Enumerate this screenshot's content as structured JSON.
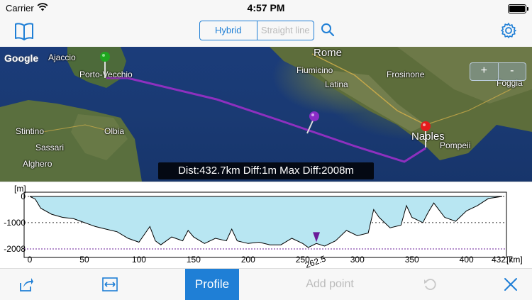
{
  "status_bar": {
    "carrier": "Carrier",
    "time": "4:57 PM"
  },
  "nav": {
    "modes": [
      "Hybrid",
      "Straight line"
    ],
    "selected_mode": "Hybrid",
    "icons": [
      "book-icon",
      "search-icon",
      "gear-icon"
    ]
  },
  "map": {
    "provider": "Google",
    "cities": {
      "ajaccio": "Ajaccio",
      "porto_vecchio": "Porto-Vecchio",
      "rome": "Rome",
      "fiumicino": "Fiumicino",
      "frosinone": "Frosinone",
      "latina": "Latina",
      "naples": "Naples",
      "pompeii": "Pompeii",
      "foggia": "Foggia",
      "stintino": "Stintino",
      "olbia": "Olbia",
      "sassari": "Sassari",
      "alghero": "Alghero"
    },
    "zoom": {
      "in_label": "+",
      "out_label": "-"
    },
    "distance_label": "Dist:432.7km Diff:1m Max Diff:2008m",
    "colors": {
      "route": "#9b30c8",
      "start_pin": "#1fa51f",
      "end_pin": "#e51c1c",
      "mid_pin": "#8a2cc7"
    }
  },
  "profile": {
    "unit_y": "[m]",
    "unit_x": "[km]",
    "y_ticks": [
      "0",
      "-1000",
      "-2008"
    ],
    "x_ticks": [
      "0",
      "50",
      "100",
      "150",
      "200",
      "250",
      "300",
      "350",
      "400",
      "432.7"
    ],
    "marker_label": "262.5",
    "colors": {
      "fill": "#b8e6f2",
      "marker": "#6a1b9a",
      "min_line": "#6a1b9a"
    }
  },
  "toolbar": {
    "profile_label": "Profile",
    "add_point_label": "Add point",
    "icons": [
      "share-icon",
      "fit-width-icon",
      "undo-icon",
      "close-icon"
    ]
  },
  "chart_data": {
    "type": "area",
    "title": "",
    "xlabel": "[km]",
    "ylabel": "[m]",
    "xlim": [
      0,
      432.7
    ],
    "ylim": [
      -2008,
      0
    ],
    "x": [
      0,
      5,
      10,
      20,
      30,
      40,
      50,
      60,
      70,
      80,
      90,
      100,
      110,
      115,
      120,
      130,
      140,
      145,
      150,
      160,
      170,
      180,
      185,
      190,
      200,
      210,
      220,
      230,
      240,
      250,
      255,
      262.5,
      270,
      280,
      290,
      300,
      310,
      315,
      320,
      330,
      340,
      345,
      350,
      360,
      365,
      370,
      380,
      390,
      400,
      410,
      420,
      432.7
    ],
    "series": [
      {
        "values": [
          0,
          -100,
          -450,
          -680,
          -800,
          -850,
          -1000,
          -1150,
          -1250,
          -1350,
          -1600,
          -1750,
          -1150,
          -1700,
          -1850,
          -1550,
          -1700,
          -1300,
          -1550,
          -1800,
          -1600,
          -1700,
          -1250,
          -1700,
          -1800,
          -1750,
          -1850,
          -1850,
          -1600,
          -1800,
          -1950,
          -1800,
          -1900,
          -1700,
          -1300,
          -1500,
          -1400,
          -500,
          -800,
          -1200,
          -1100,
          -350,
          -800,
          -1000,
          -600,
          -250,
          -800,
          -950,
          -550,
          -350,
          -80,
          0
        ]
      }
    ]
  }
}
